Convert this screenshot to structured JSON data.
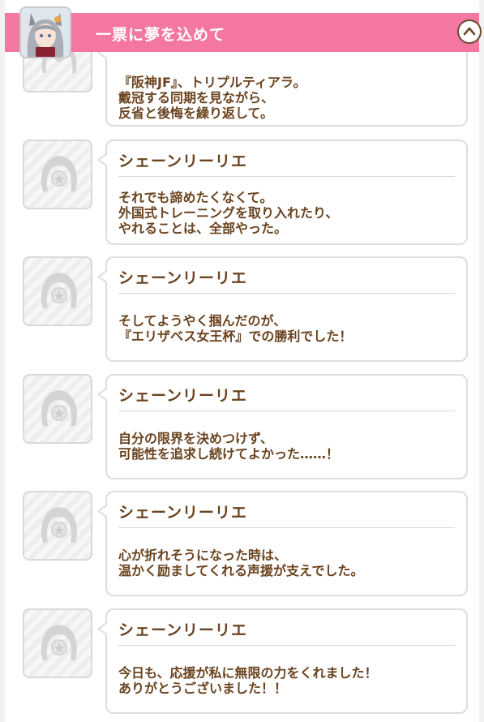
{
  "header": {
    "title": "一票に夢を込めて",
    "collapse_icon": "chevron-up-icon",
    "avatar_icon": "character-portrait-icon"
  },
  "partial_entry": {
    "lines": [
      "『阪神JF』、トリプルティアラ。",
      "戴冠する同期を見ながら、",
      "反省と後悔を繰り返して。"
    ]
  },
  "entries": [
    {
      "speaker": "シェーンリーリエ",
      "lines": [
        "それでも諦めたくなくて。",
        "外国式トレーニングを取り入れたり、",
        "やれることは、全部やった。"
      ]
    },
    {
      "speaker": "シェーンリーリエ",
      "lines": [
        "そしてようやく掴んだのが、",
        "『エリザベス女王杯』での勝利でした！"
      ]
    },
    {
      "speaker": "シェーンリーリエ",
      "lines": [
        "自分の限界を決めつけず、",
        "可能性を追求し続けてよかった……！"
      ]
    },
    {
      "speaker": "シェーンリーリエ",
      "lines": [
        "心が折れそうになった時は、",
        "温かく励ましてくれる声援が支えでした。"
      ]
    },
    {
      "speaker": "シェーンリーリエ",
      "lines": [
        "今日も、応援が私に無限の力をくれました！",
        "ありがとうございました！！"
      ]
    }
  ],
  "colors": {
    "header_bg": "#f477a2",
    "text_brown": "#6a431f",
    "speaker_placeholder": "horseshoe-icon"
  }
}
